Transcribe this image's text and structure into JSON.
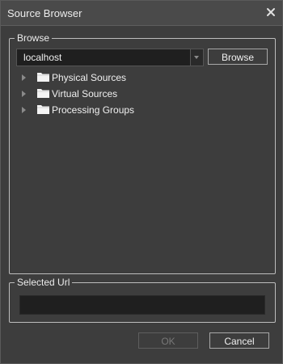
{
  "window": {
    "title": "Source Browser"
  },
  "browse": {
    "legend": "Browse",
    "host_value": "localhost",
    "browse_button": "Browse",
    "tree": [
      {
        "label": "Physical Sources"
      },
      {
        "label": "Virtual Sources"
      },
      {
        "label": "Processing Groups"
      }
    ]
  },
  "selected_url": {
    "legend": "Selected Url",
    "value": ""
  },
  "buttons": {
    "ok": "OK",
    "cancel": "Cancel"
  },
  "icons": {
    "close": "close-icon",
    "folder": "folder-icon",
    "expander": "triangle-right-icon",
    "dropdown": "chevron-down-icon"
  },
  "colors": {
    "background": "#3d3d3d",
    "titlebar": "#4a4a4a",
    "field": "#1f1f1f",
    "text": "#f0f0f0",
    "disabled_text": "#777777"
  }
}
